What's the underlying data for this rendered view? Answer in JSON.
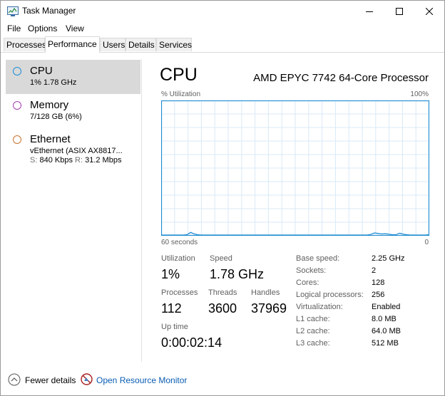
{
  "window": {
    "title": "Task Manager"
  },
  "menu": [
    "File",
    "Options",
    "View"
  ],
  "tabs": [
    "Processes",
    "Performance",
    "Users",
    "Details",
    "Services"
  ],
  "sidebar": {
    "items": [
      {
        "name": "CPU",
        "sub": "1% 1.78 GHz",
        "color": "#1f8fd6"
      },
      {
        "name": "Memory",
        "sub": "7/128 GB (6%)",
        "color": "#a73bb5"
      },
      {
        "name": "Ethernet",
        "sub": "vEthernet (ASIX AX8817...",
        "send_label": "S:",
        "send": "840 Kbps",
        "recv_label": "R:",
        "recv": "31.2 Mbps",
        "color": "#c9742f"
      }
    ]
  },
  "cpu": {
    "title": "CPU",
    "model": "AMD EPYC 7742 64-Core Processor",
    "util_label": "% Utilization",
    "util_max": "100%",
    "time_label": "60 seconds",
    "time_end": "0",
    "graph_color": "#1d8bd1",
    "graph_values": [
      0,
      0,
      0,
      0,
      0,
      0,
      0,
      0.3,
      2.0,
      0.8,
      0.2,
      0,
      0,
      0,
      0,
      0,
      0,
      0,
      0,
      0,
      0,
      0,
      0,
      0,
      0,
      0,
      0,
      0,
      0,
      0,
      0,
      0,
      0,
      0,
      0,
      0,
      0,
      0,
      0,
      0,
      0,
      0,
      0,
      0,
      0,
      0,
      0,
      0,
      0,
      0,
      0,
      0,
      0,
      0,
      0,
      0,
      0,
      0,
      0.5,
      1.6,
      1.2,
      0.8,
      1.0,
      0.6,
      0.2,
      0.3,
      1.4,
      0.6,
      0.2,
      0,
      0,
      0,
      0,
      0,
      0.2
    ],
    "stats": {
      "utilization_label": "Utilization",
      "utilization": "1%",
      "speed_label": "Speed",
      "speed": "1.78 GHz",
      "processes_label": "Processes",
      "processes": "112",
      "threads_label": "Threads",
      "threads": "3600",
      "handles_label": "Handles",
      "handles": "37969",
      "uptime_label": "Up time",
      "uptime": "0:00:02:14"
    },
    "specs": [
      {
        "label": "Base speed:",
        "value": "2.25 GHz"
      },
      {
        "label": "Sockets:",
        "value": "2"
      },
      {
        "label": "Cores:",
        "value": "128"
      },
      {
        "label": "Logical processors:",
        "value": "256"
      },
      {
        "label": "Virtualization:",
        "value": "Enabled"
      },
      {
        "label": "L1 cache:",
        "value": "8.0 MB"
      },
      {
        "label": "L2 cache:",
        "value": "64.0 MB"
      },
      {
        "label": "L3 cache:",
        "value": "512 MB"
      }
    ]
  },
  "footer": {
    "fewer_details": "Fewer details",
    "resource_monitor": "Open Resource Monitor"
  }
}
